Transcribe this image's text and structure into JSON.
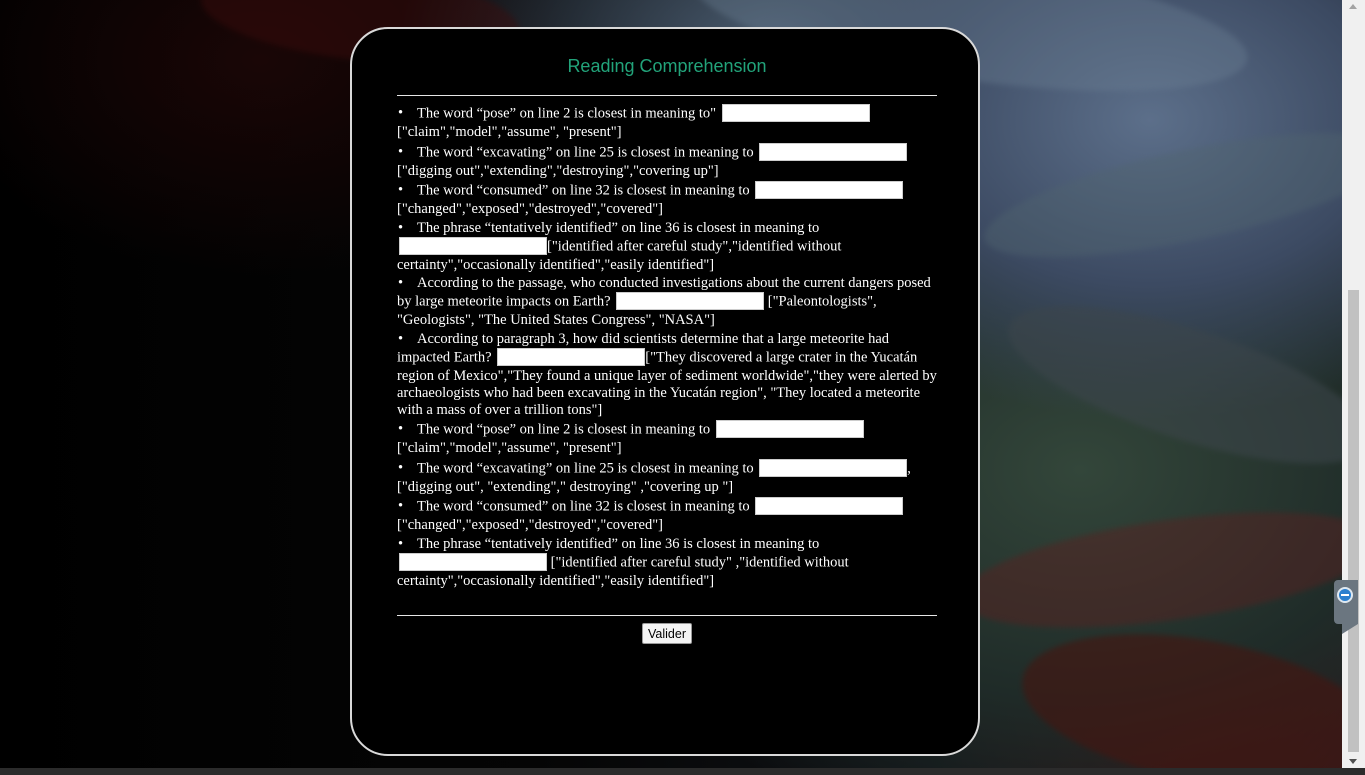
{
  "page": {
    "title": "Reading Comprehension",
    "submit_label": "Valider"
  },
  "colors": {
    "title": "#22a37a",
    "panel_background": "#000000",
    "panel_border": "#d9d9d9",
    "text": "#ffffff"
  },
  "questions": [
    {
      "prompt": "The word “pose” on line 2 is closest in meaning to\"",
      "input_value": "",
      "options": "[\"claim\",\"model\",\"assume\", \"present\"]"
    },
    {
      "prompt": "The word “excavating” on line 25 is closest in meaning to",
      "input_value": "",
      "options": "[\"digging out\",\"extending\",\"destroying\",\"covering up\"]"
    },
    {
      "prompt": "The word “consumed” on line 32 is closest in meaning to",
      "input_value": "",
      "options": "[\"changed\",\"exposed\",\"destroyed\",\"covered\"]"
    },
    {
      "prompt": "The phrase “tentatively identified” on line 36 is closest in meaning to",
      "input_value": "",
      "options": "[\"identified after careful study\",\"identified without certainty\",\"occasionally identified\",\"easily identified\"]"
    },
    {
      "prompt": "According to the passage, who conducted investigations about the current dangers posed by large meteorite impacts on Earth?",
      "input_value": "",
      "options": " [\"Paleontologists\", \"Geologists\", \"The United States Congress\", \"NASA\"]"
    },
    {
      "prompt": "According to paragraph 3, how did scientists determine that a large meteorite had impacted Earth?",
      "input_value": "",
      "options": "[\"They discovered a large crater in the Yucatán region of Mexico\",\"They found a unique layer of sediment worldwide\",\"they were alerted by archaeologists who had been excavating in the Yucatán region\", \"They located a meteorite with a mass of over a trillion tons\"]"
    },
    {
      "prompt": "The word “pose” on line 2 is closest in meaning to",
      "input_value": "",
      "options": "[\"claim\",\"model\",\"assume\", \"present\"]"
    },
    {
      "prompt": "The word “excavating” on line 25 is closest in meaning to",
      "input_value": "",
      "options": ", [\"digging out\", \"extending\",\" destroying\" ,\"covering up \"]"
    },
    {
      "prompt": "The word “consumed” on line 32 is closest in meaning to",
      "input_value": "",
      "options": "[\"changed\",\"exposed\",\"destroyed\",\"covered\"]"
    },
    {
      "prompt": "The phrase “tentatively identified” on line 36 is closest in meaning to",
      "input_value": "",
      "options": " [\"identified after careful study\" ,\"identified without certainty\",\"occasionally identified\",\"easily identified\"]"
    }
  ]
}
